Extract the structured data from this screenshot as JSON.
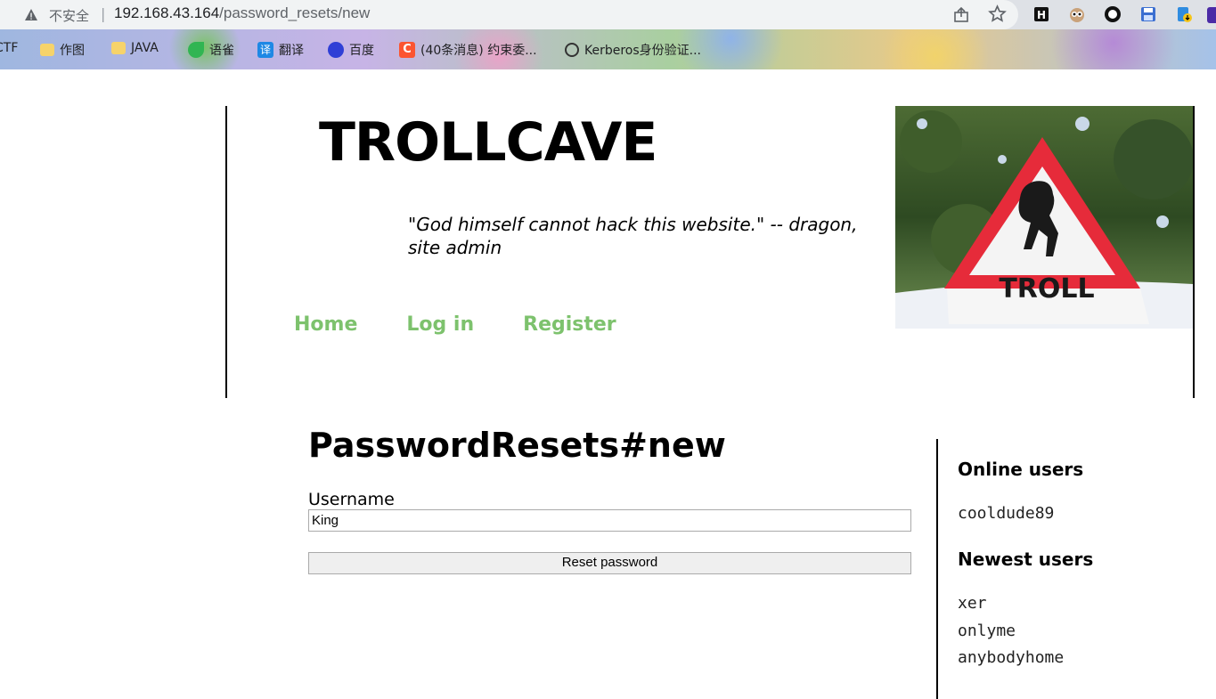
{
  "browser": {
    "security_label": "不安全",
    "url_host": "192.168.43.164",
    "url_path": "/password_resets/new",
    "bookmarks": [
      "CTF",
      "作图",
      "JAVA",
      "语雀",
      "翻译",
      "百度",
      "(40条消息) 约束委...",
      "Kerberos身份验证..."
    ],
    "colors": {
      "chrome_bg": "#dee1e6",
      "omnibox_bg": "#f1f3f4"
    }
  },
  "site": {
    "title": "TROLLCAVE",
    "tagline": "\"God himself cannot hack this website.\" -- dragon, site admin",
    "nav": [
      "Home",
      "Log in",
      "Register"
    ],
    "nav_color": "#7dc26d",
    "sign_text": "TROLL"
  },
  "main": {
    "heading": "PasswordResets#new",
    "username_label": "Username",
    "username_value": "King",
    "submit_label": "Reset password"
  },
  "sidebar": {
    "online_heading": "Online users",
    "online_users": [
      "cooldude89"
    ],
    "newest_heading": "Newest users",
    "newest_users": [
      "xer",
      "onlyme",
      "anybodyhome"
    ]
  }
}
